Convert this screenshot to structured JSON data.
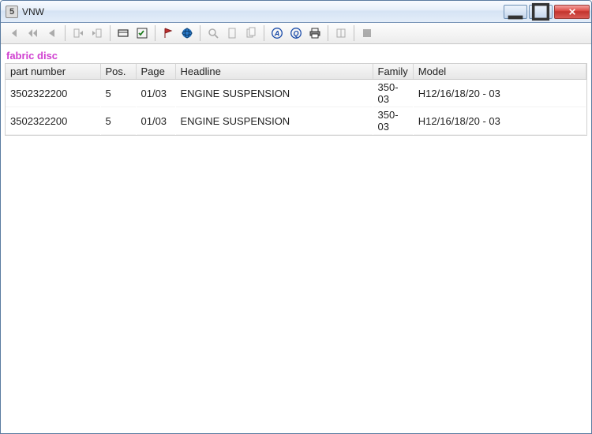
{
  "window": {
    "title": "VNW"
  },
  "filter_label": "fabric disc",
  "toolbar": {
    "icons": [
      "first-icon",
      "prev-fast-icon",
      "prev-icon",
      "record-prev-icon",
      "record-next-icon",
      "card-icon",
      "check-icon",
      "flag-icon",
      "globe-icon",
      "zoom-icon",
      "copy1-icon",
      "copy2-icon",
      "letter-a-icon",
      "letter-q-icon",
      "print-icon",
      "book-icon",
      "stop-icon"
    ]
  },
  "columns": {
    "part": "part number",
    "pos": "Pos.",
    "page": "Page",
    "headline": "Headline",
    "family": "Family",
    "model": "Model"
  },
  "rows": [
    {
      "part": "3502322200",
      "pos": "5",
      "page": "01/03",
      "headline": "ENGINE SUSPENSION",
      "family": "350-03",
      "model": "H12/16/18/20 - 03"
    },
    {
      "part": "3502322200",
      "pos": "5",
      "page": "01/03",
      "headline": "ENGINE SUSPENSION",
      "family": "350-03",
      "model": "H12/16/18/20 - 03"
    }
  ]
}
